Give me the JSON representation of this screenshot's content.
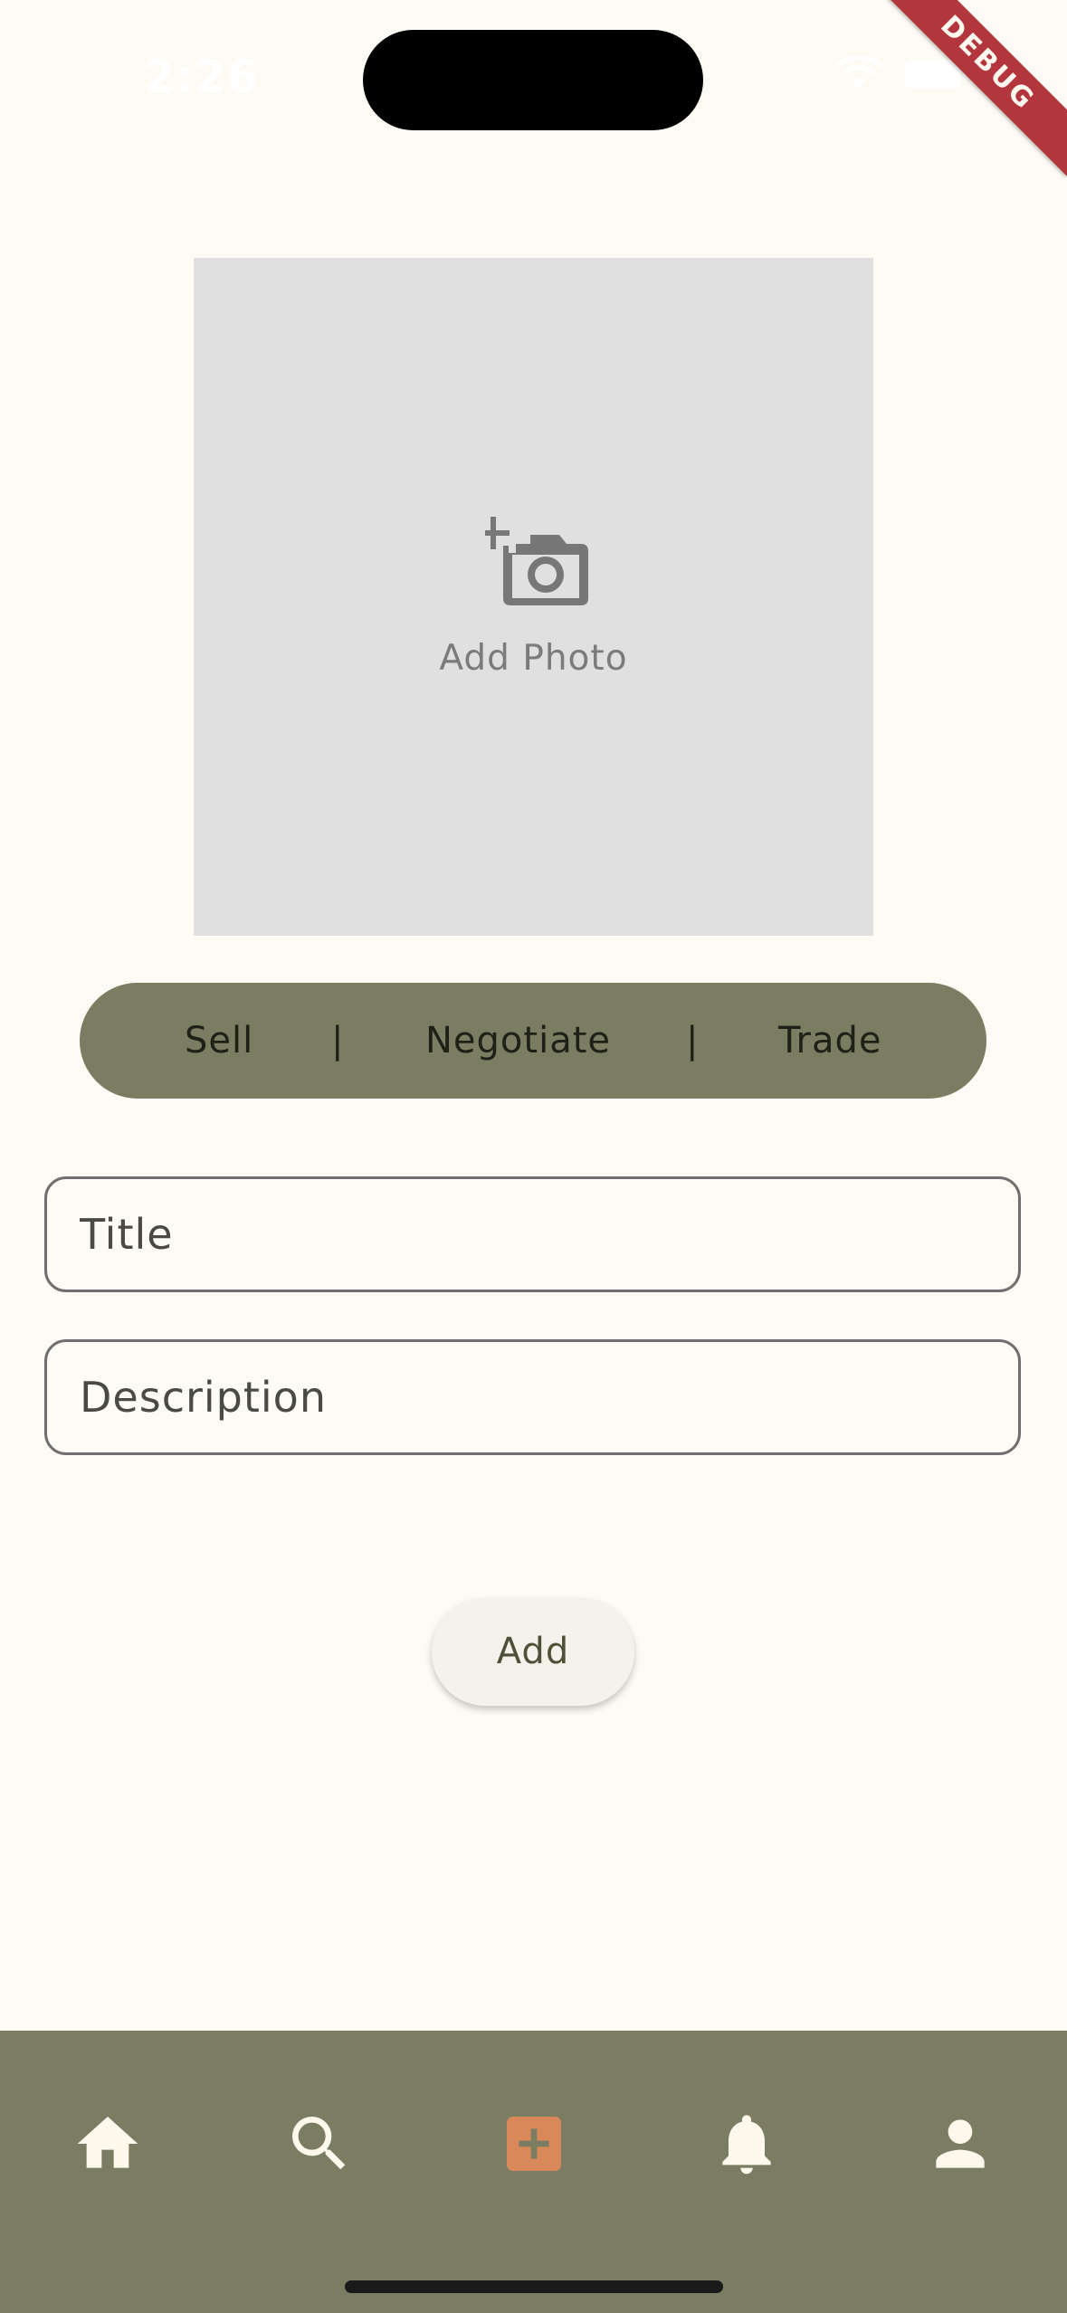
{
  "status_bar": {
    "time": "2:26"
  },
  "debug_banner": {
    "label": "DEBUG"
  },
  "photo_picker": {
    "label": "Add Photo",
    "icon": "add-a-photo-icon"
  },
  "mode_selector": {
    "options": [
      "Sell",
      "Negotiate",
      "Trade"
    ],
    "separator": "|"
  },
  "form": {
    "title_placeholder": "Title",
    "description_placeholder": "Description",
    "add_label": "Add"
  },
  "bottom_nav": {
    "items": [
      {
        "icon": "home-icon"
      },
      {
        "icon": "search-icon"
      },
      {
        "icon": "add-box-icon",
        "active": true
      },
      {
        "icon": "bell-icon"
      },
      {
        "icon": "person-icon"
      }
    ]
  },
  "colors": {
    "background": "#FDFBF4",
    "olive": "#7A7D62",
    "photo_box": "#E0E0E0",
    "active_icon": "#D9885A",
    "nav_icon": "#FFF8EC",
    "debug": "#B3353D"
  }
}
